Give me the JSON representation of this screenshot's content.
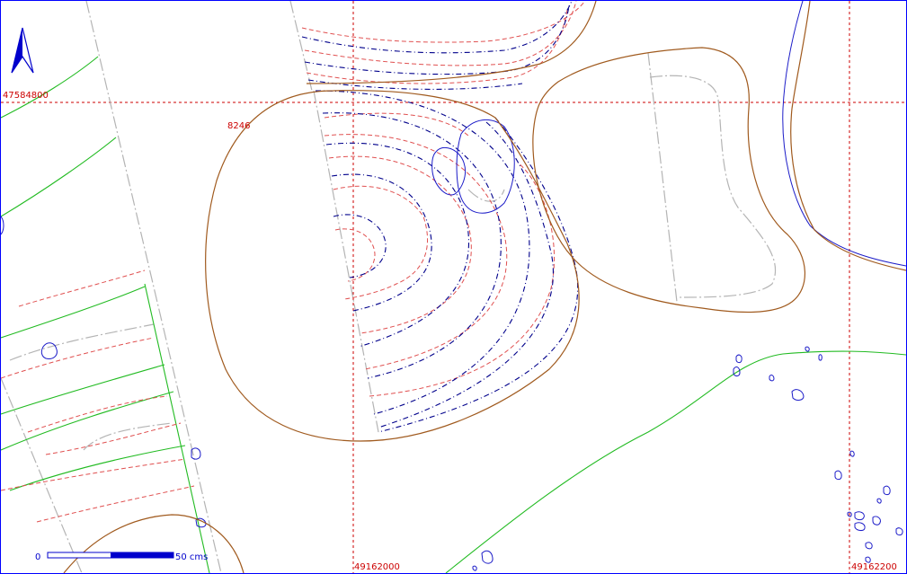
{
  "map": {
    "north_arrow": "north-arrow-icon",
    "grid_labels": {
      "northing": "47584800",
      "easting_1": "49162000",
      "easting_2": "49162200"
    },
    "spot_height": "8246",
    "scale_bar": {
      "start_label": "0",
      "end_label": "50 cms"
    },
    "colors": {
      "grid": "#cc0000",
      "boundary": "#a05a1e",
      "contour_blue": "#00008b",
      "contour_red": "#e05050",
      "green_line": "#22bb22",
      "gray_line": "#b4b4b4",
      "frame": "#0000ff"
    }
  }
}
